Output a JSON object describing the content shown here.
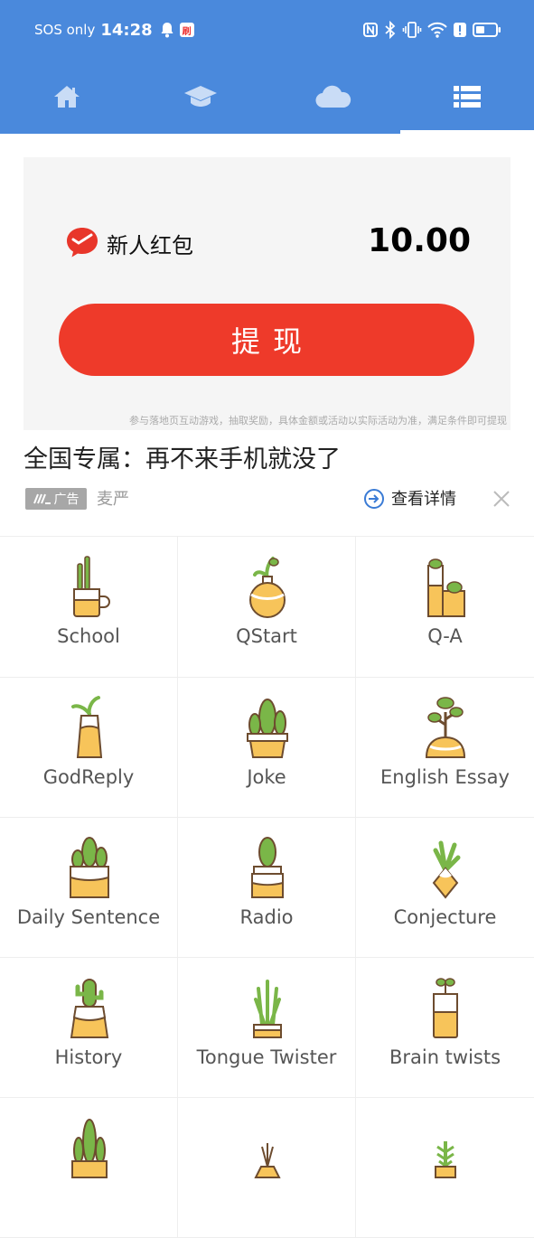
{
  "status_bar": {
    "carrier": "SOS only",
    "time": "14:28",
    "notification_badge": "刷"
  },
  "tabs": [
    {
      "icon": "home-icon",
      "active": false
    },
    {
      "icon": "graduation-cap-icon",
      "active": false
    },
    {
      "icon": "cloud-icon",
      "active": false
    },
    {
      "icon": "list-icon",
      "active": true
    }
  ],
  "ad": {
    "red_packet_title": "新人红包",
    "amount": "10.00",
    "withdraw_button": "提现",
    "disclaimer": "参与落地页互动游戏，抽取奖励，具体金额或活动以实际活动为准，满足条件即可提现",
    "headline": "全国专属：再不来手机就没了",
    "badge": "广告",
    "source": "麦严",
    "detail_link": "查看详情"
  },
  "grid": {
    "rows": [
      [
        {
          "label": "School",
          "icon": "cactus-mug-icon"
        },
        {
          "label": "QStart",
          "icon": "round-vase-plant-icon"
        },
        {
          "label": "Q-A",
          "icon": "cactus-pot-icon"
        }
      ],
      [
        {
          "label": "GodReply",
          "icon": "tall-vase-plant-icon"
        },
        {
          "label": "Joke",
          "icon": "cactus-planter-icon"
        },
        {
          "label": "English Essay",
          "icon": "bonsai-icon"
        }
      ],
      [
        {
          "label": "Daily Sentence",
          "icon": "cactus-square-pot-icon"
        },
        {
          "label": "Radio",
          "icon": "small-cactus-pot-icon"
        },
        {
          "label": "Conjecture",
          "icon": "succulent-vase-icon"
        }
      ],
      [
        {
          "label": "History",
          "icon": "cactus-bucket-icon"
        },
        {
          "label": "Tongue Twister",
          "icon": "aloe-pot-icon"
        },
        {
          "label": "Brain twists",
          "icon": "sprout-jar-icon"
        }
      ],
      [
        {
          "label": "",
          "icon": "cactus-cluster-icon"
        },
        {
          "label": "",
          "icon": "grass-vase-icon"
        },
        {
          "label": "",
          "icon": "succulent-tower-icon"
        }
      ]
    ]
  },
  "colors": {
    "header_blue": "#4a89dc",
    "button_red": "#ee3a2a",
    "plant_green": "#7ab648",
    "pot_yellow": "#f7c45a"
  }
}
